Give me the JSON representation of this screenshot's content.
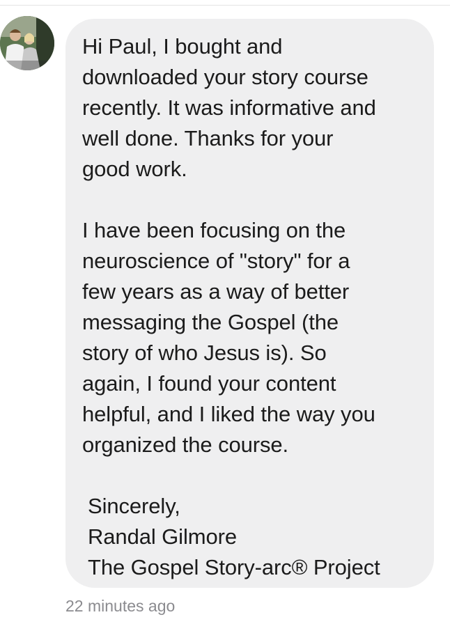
{
  "message": {
    "sender_avatar_icon": "profile-photo",
    "paragraphs": [
      "Hi Paul, I bought and\ndownloaded your story course\nrecently. It was informative and\nwell done. Thanks for your\ngood work.",
      " I have been focusing on the\nneuroscience of \"story\" for a\nfew years as a way of better\nmessaging the Gospel (the\nstory of who Jesus is). So\nagain, I found your content\nhelpful, and I liked the way you\norganized the course.",
      "Sincerely,\nRandal Gilmore\nThe Gospel Story-arc® Project"
    ],
    "timestamp": "22 minutes ago"
  },
  "colors": {
    "bubble_background": "#efeff0",
    "message_text": "#1b1b1b",
    "timestamp_text": "#8b8b8f"
  }
}
